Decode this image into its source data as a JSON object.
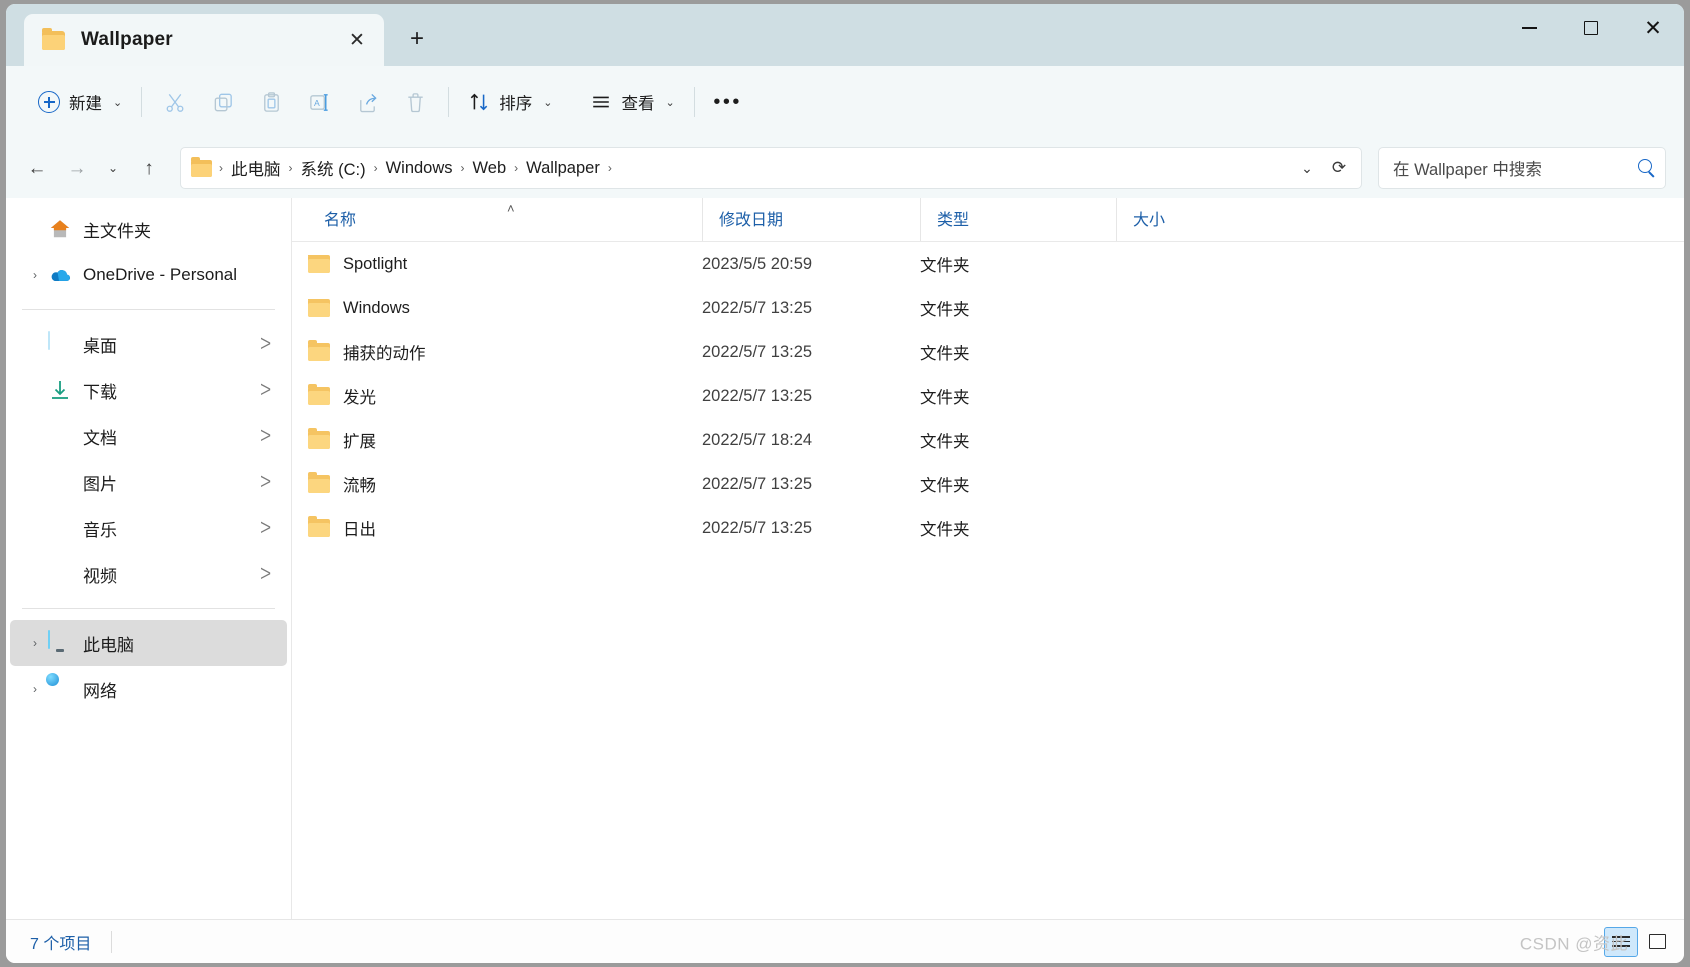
{
  "window": {
    "tab_title": "Wallpaper",
    "tab_close_glyph": "✕",
    "new_tab_glyph": "+",
    "minimize_label": "—",
    "maximize_label": "□",
    "close_glyph": "✕"
  },
  "toolbar": {
    "new_label": "新建",
    "new_chevron": "⌄",
    "cut_label": "✂",
    "copy_label": "copy",
    "paste_label": "paste",
    "rename_label": "rename",
    "share_label": "share",
    "delete_label": "delete",
    "sort_label": "排序",
    "sort_chevron": "⌄",
    "view_label": "查看",
    "view_chevron": "⌄",
    "more_label": "•••"
  },
  "addressbar": {
    "back_glyph": "←",
    "forward_glyph": "→",
    "recent_glyph": "⌄",
    "up_glyph": "↑",
    "dropdown_glyph": "⌄",
    "refresh_glyph": "⟳",
    "crumbs": [
      {
        "label": "此电脑"
      },
      {
        "label": "系统 (C:)"
      },
      {
        "label": "Windows"
      },
      {
        "label": "Web"
      },
      {
        "label": "Wallpaper"
      }
    ],
    "separator": "›"
  },
  "search": {
    "placeholder": "在 Wallpaper 中搜索",
    "value": ""
  },
  "sidebar": {
    "items": [
      {
        "label": "主文件夹",
        "icon": "home-icon",
        "expandable": false,
        "pinned": false,
        "selected": false
      },
      {
        "label": "OneDrive - Personal",
        "icon": "onedrive-icon",
        "expandable": true,
        "pinned": false,
        "selected": false
      },
      {
        "label": "桌面",
        "icon": "desktop-icon",
        "expandable": false,
        "pinned": true,
        "selected": false
      },
      {
        "label": "下载",
        "icon": "download-icon",
        "expandable": false,
        "pinned": true,
        "selected": false
      },
      {
        "label": "文档",
        "icon": "documents-icon",
        "expandable": false,
        "pinned": true,
        "selected": false
      },
      {
        "label": "图片",
        "icon": "pictures-icon",
        "expandable": false,
        "pinned": true,
        "selected": false
      },
      {
        "label": "音乐",
        "icon": "music-icon",
        "expandable": false,
        "pinned": true,
        "selected": false
      },
      {
        "label": "视频",
        "icon": "videos-icon",
        "expandable": false,
        "pinned": true,
        "selected": false
      },
      {
        "label": "此电脑",
        "icon": "this-pc-icon",
        "expandable": true,
        "pinned": false,
        "selected": true
      },
      {
        "label": "网络",
        "icon": "network-icon",
        "expandable": true,
        "pinned": false,
        "selected": false
      }
    ],
    "expand_glyph": "›",
    "pin_glyph": "ᐳ"
  },
  "filelist": {
    "columns": [
      {
        "label": "名称"
      },
      {
        "label": "修改日期"
      },
      {
        "label": "类型"
      },
      {
        "label": "大小"
      }
    ],
    "sort_caret": "˄",
    "rows": [
      {
        "name": "Spotlight",
        "date": "2023/5/5 20:59",
        "type": "文件夹",
        "size": ""
      },
      {
        "name": "Windows",
        "date": "2022/5/7 13:25",
        "type": "文件夹",
        "size": ""
      },
      {
        "name": "捕获的动作",
        "date": "2022/5/7 13:25",
        "type": "文件夹",
        "size": ""
      },
      {
        "name": "发光",
        "date": "2022/5/7 13:25",
        "type": "文件夹",
        "size": ""
      },
      {
        "name": "扩展",
        "date": "2022/5/7 18:24",
        "type": "文件夹",
        "size": ""
      },
      {
        "name": "流畅",
        "date": "2022/5/7 13:25",
        "type": "文件夹",
        "size": ""
      },
      {
        "name": "日出",
        "date": "2022/5/7 13:25",
        "type": "文件夹",
        "size": ""
      }
    ]
  },
  "statusbar": {
    "item_count": "7 个项目",
    "watermark": "CSDN @资此",
    "details_view_label": "details-view",
    "tiles_view_label": "tiles-view"
  },
  "colors": {
    "titlebar": "#cfdee3",
    "toolbar": "#f3f8f9",
    "accent": "#1767c7",
    "folder": "#fcd278",
    "selection": "#dcdcdc",
    "header_text": "#1d5fa8"
  }
}
